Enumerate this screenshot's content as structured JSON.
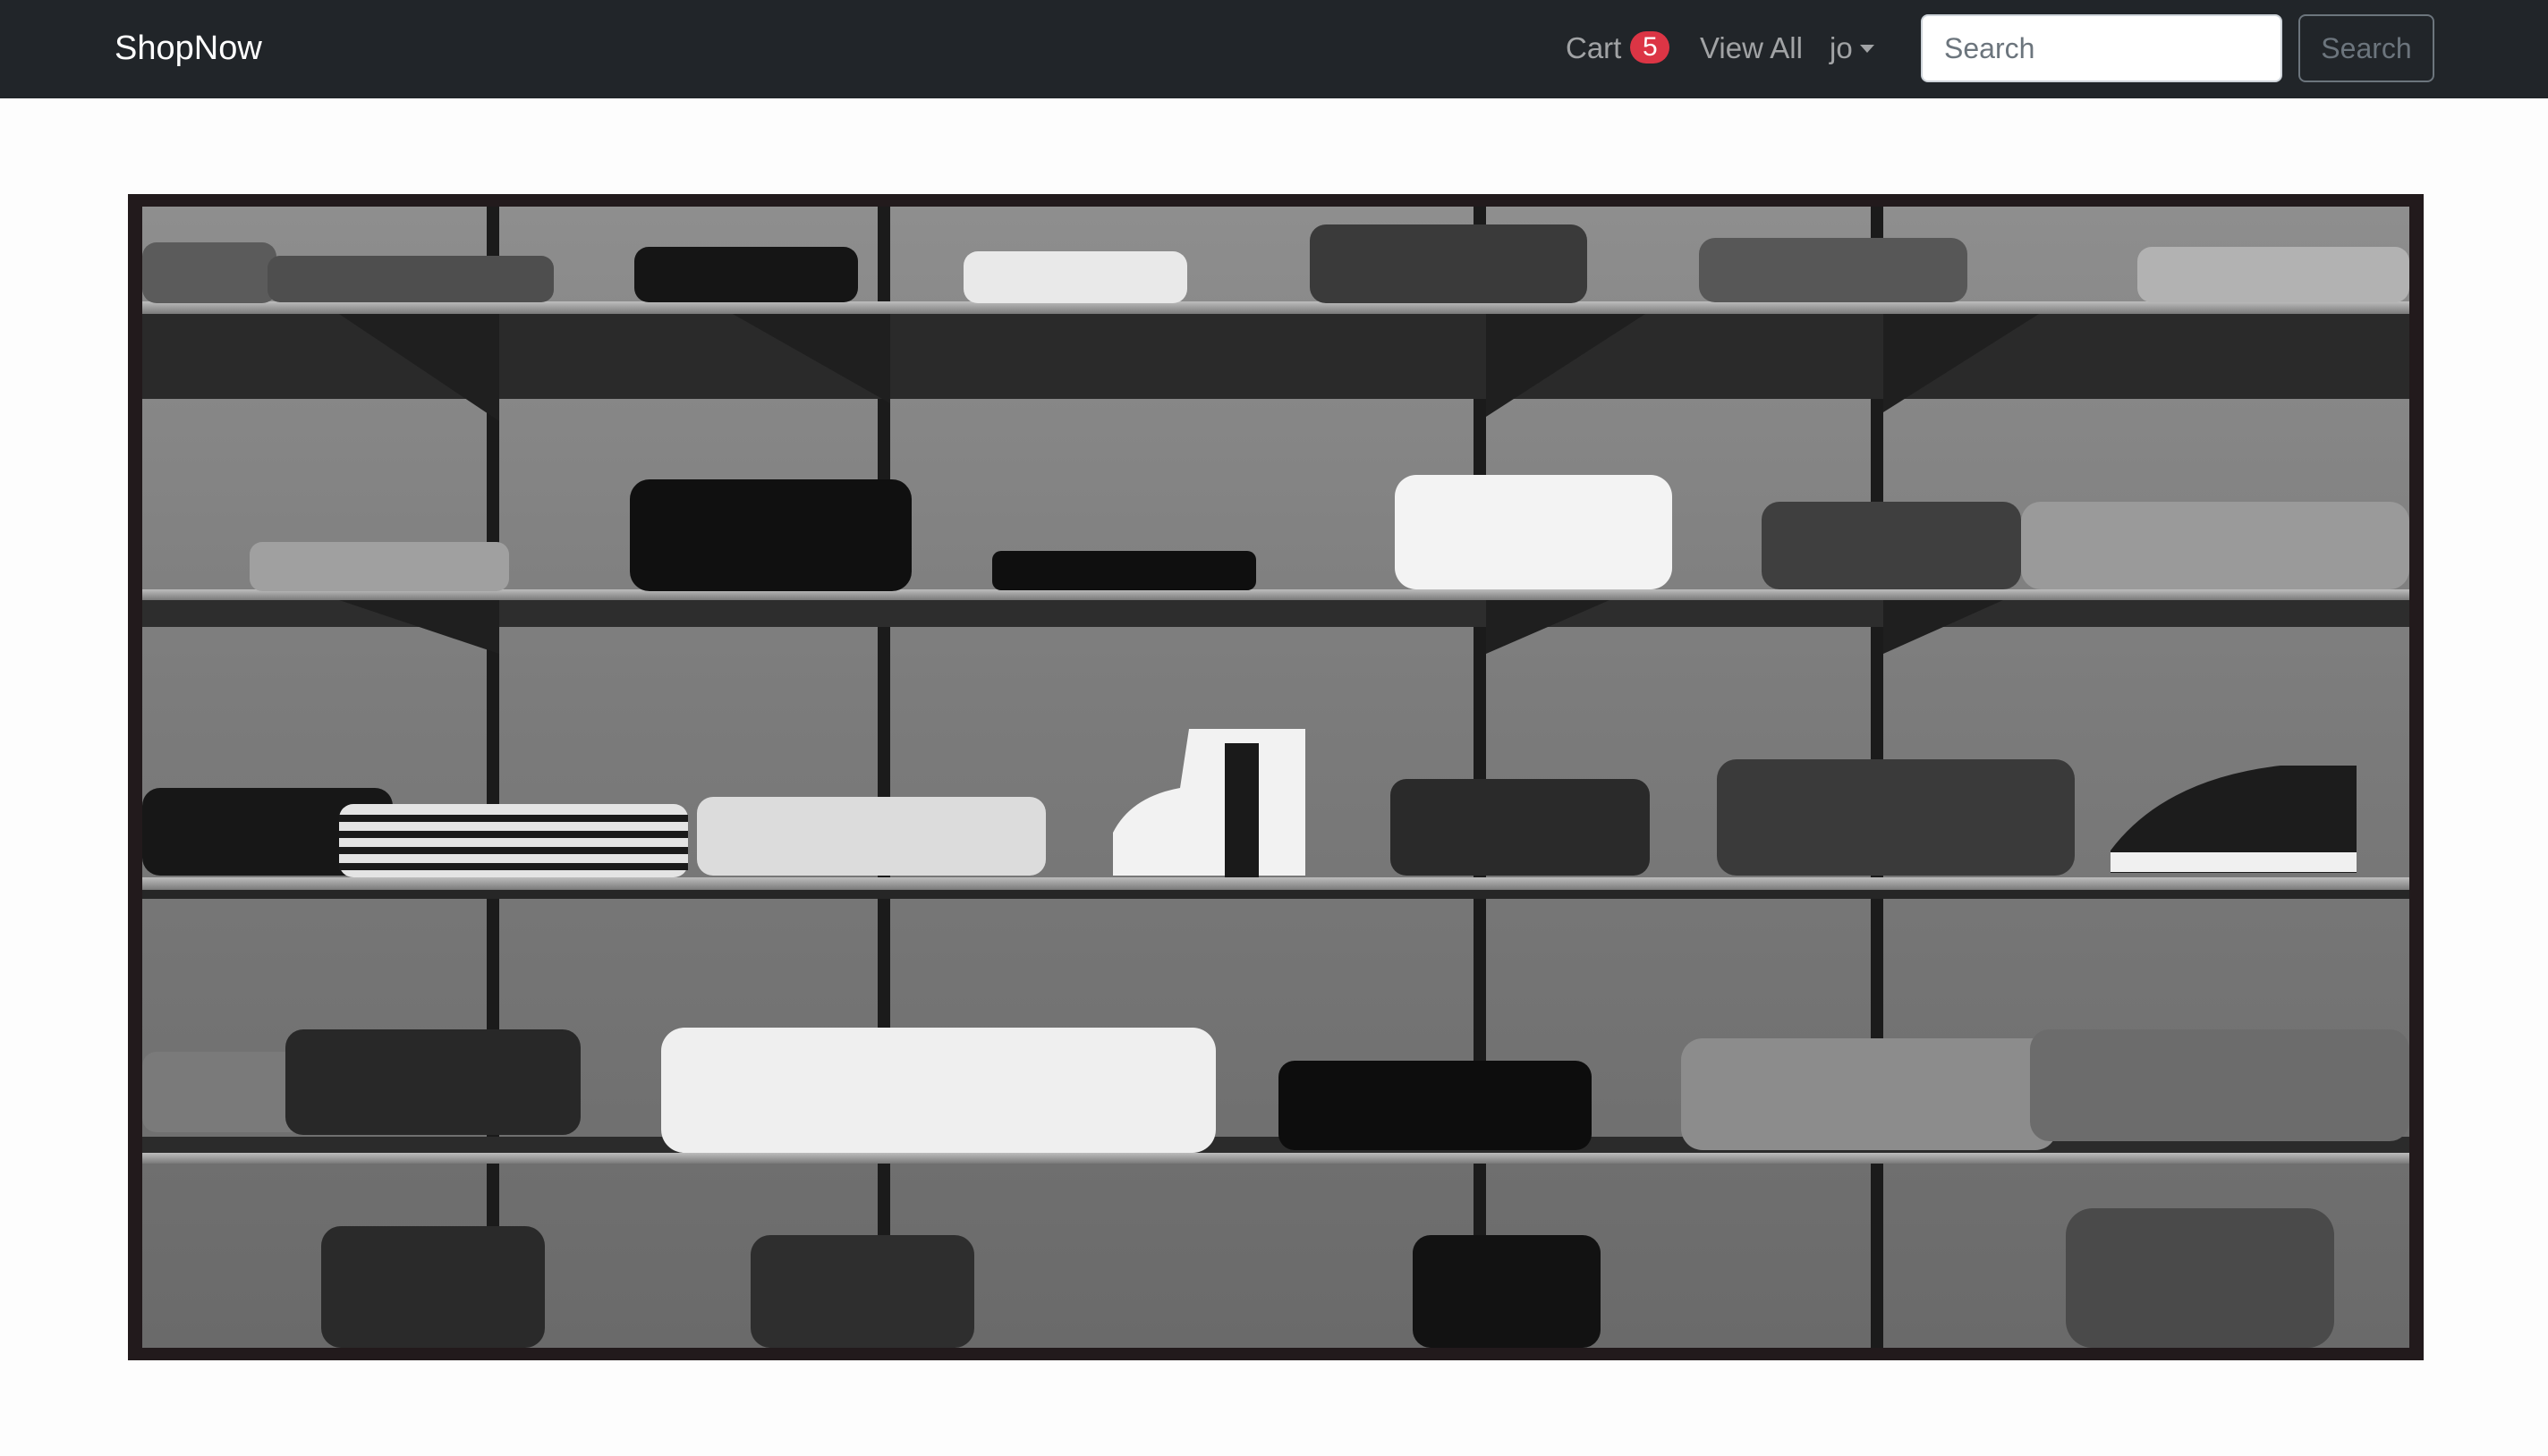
{
  "navbar": {
    "brand": "ShopNow",
    "cart_label": "Cart",
    "cart_count": "5",
    "view_all_label": "View All",
    "user_label": "jo",
    "search_placeholder": "Search",
    "search_value": "",
    "search_button_label": "Search"
  },
  "colors": {
    "navbar_bg": "#212529",
    "badge_bg": "#dc3545",
    "page_bg": "#fdfdfd"
  },
  "icons": {
    "user_menu": "caret-down-icon"
  }
}
